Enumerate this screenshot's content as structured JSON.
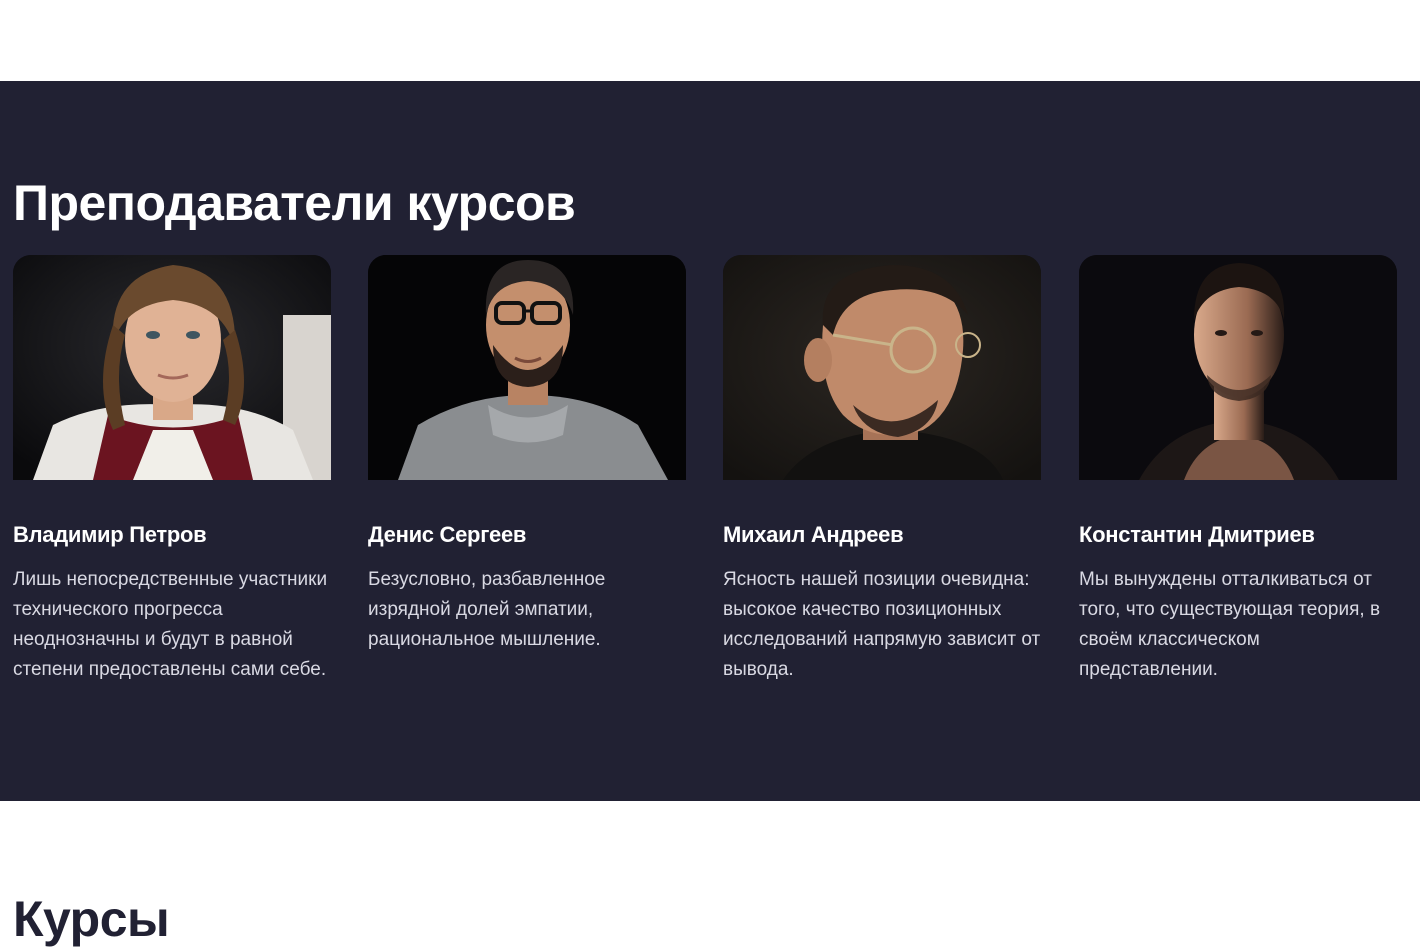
{
  "teachers_section": {
    "title": "Преподаватели курсов",
    "cards": [
      {
        "photo": "portrait-long-hair-man",
        "name": "Владимир Петров",
        "description": "Лишь непосредственные участники технического прогресса неоднозначны и будут в равной степени предоставлены сами себе."
      },
      {
        "photo": "portrait-man-glasses-beard",
        "name": "Денис Сергеев",
        "description": "Безусловно, разбавленное изрядной долей эмпатии, рациональное мышление."
      },
      {
        "photo": "portrait-man-round-glasses-profile",
        "name": "Михаил Андреев",
        "description": "Ясность нашей позиции очевидна: высокое качество позиционных исследований напрямую зависит от вывода."
      },
      {
        "photo": "portrait-man-dark-lighting",
        "name": "Константин Дмитриев",
        "description": "Мы вынуждены отталкиваться от того, что существующая теория, в своём классическом представлении."
      }
    ]
  },
  "courses_section": {
    "title": "Курсы"
  }
}
